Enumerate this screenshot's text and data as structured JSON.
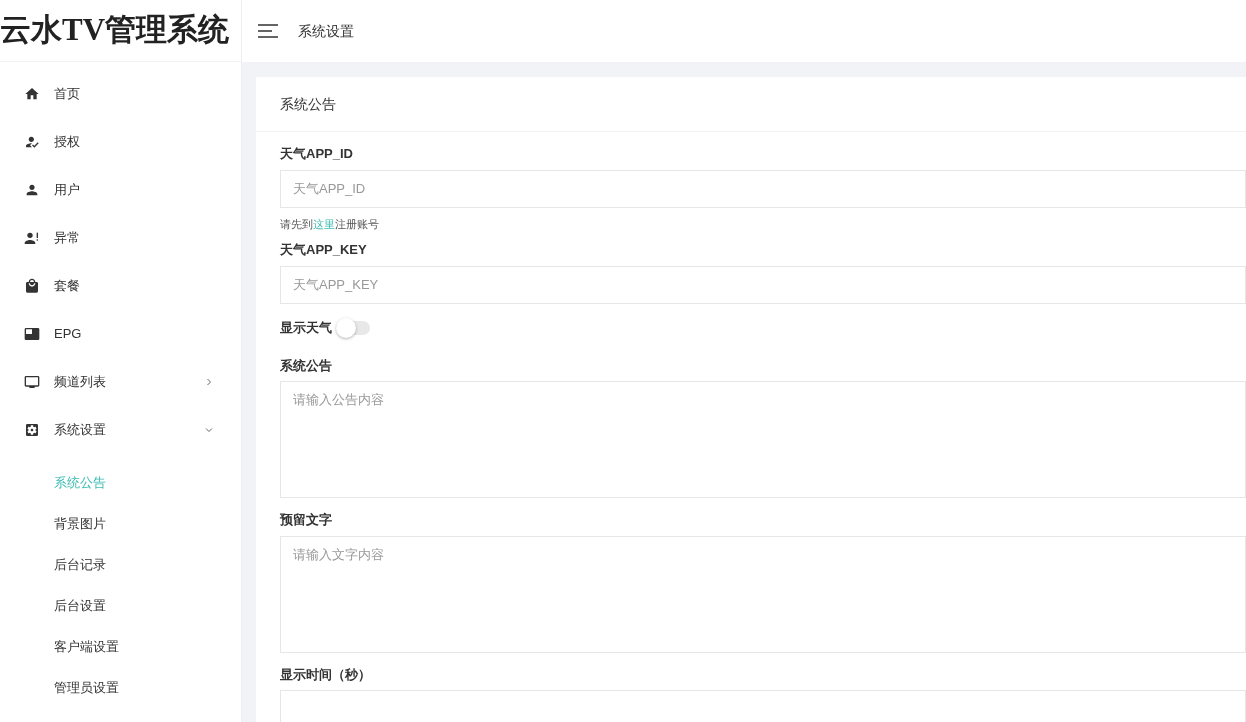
{
  "brand": {
    "title": "云水TV管理系统"
  },
  "header": {
    "breadcrumb": "系统设置"
  },
  "sidebar": {
    "items": [
      {
        "label": "首页",
        "selected": false
      },
      {
        "label": "授权",
        "selected": false
      },
      {
        "label": "用户",
        "selected": false
      },
      {
        "label": "异常",
        "selected": false
      },
      {
        "label": "套餐",
        "selected": false
      },
      {
        "label": "EPG",
        "selected": false
      },
      {
        "label": "频道列表",
        "selected": false,
        "expanded": false
      },
      {
        "label": "系统设置",
        "selected": false,
        "expanded": true,
        "children": [
          {
            "label": "系统公告",
            "selected": true
          },
          {
            "label": "背景图片",
            "selected": false
          },
          {
            "label": "后台记录",
            "selected": false
          },
          {
            "label": "后台设置",
            "selected": false
          },
          {
            "label": "客户端设置",
            "selected": false
          },
          {
            "label": "管理员设置",
            "selected": false
          }
        ]
      }
    ]
  },
  "card": {
    "title": "系统公告",
    "fields": [
      {
        "kind": "input",
        "label": "天气APP_ID",
        "placeholder": "天气APP_ID"
      },
      {
        "kind": "hint",
        "before": "请先到",
        "link": "这里",
        "after": "注册账号"
      },
      {
        "kind": "input",
        "label": "天气APP_KEY",
        "placeholder": "天气APP_KEY"
      },
      {
        "kind": "switch",
        "label": "显示天气",
        "on": false
      },
      {
        "kind": "textarea",
        "label": "系统公告",
        "placeholder": "请输入公告内容"
      },
      {
        "kind": "textarea",
        "label": "预留文字",
        "placeholder": "请输入文字内容"
      },
      {
        "kind": "input",
        "label": "显示时间（秒）"
      }
    ]
  }
}
